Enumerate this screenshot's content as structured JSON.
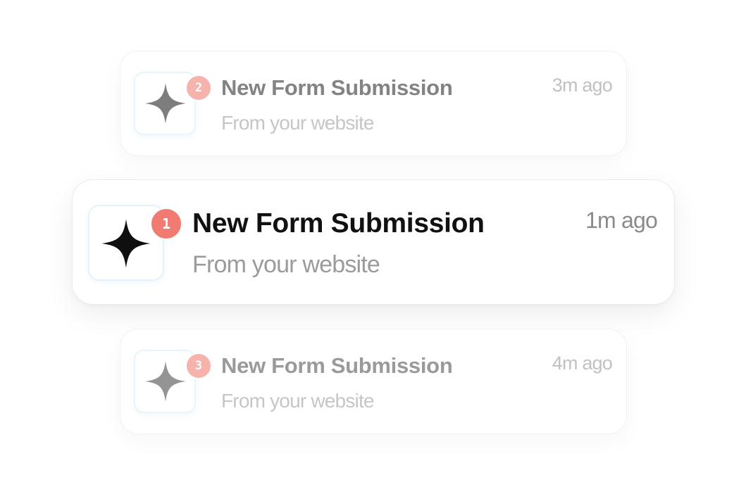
{
  "notifications": [
    {
      "badge": "2",
      "title": "New Form Submission",
      "subtitle": "From your website",
      "time": "3m ago",
      "icon": "sparkle-icon",
      "emphasis": "faded"
    },
    {
      "badge": "1",
      "title": "New Form Submission",
      "subtitle": "From your website",
      "time": "1m ago",
      "icon": "sparkle-icon",
      "emphasis": "active"
    },
    {
      "badge": "3",
      "title": "New Form Submission",
      "subtitle": "From your website",
      "time": "4m ago",
      "icon": "sparkle-icon",
      "emphasis": "faded"
    }
  ],
  "colors": {
    "badge_active": "#f17b70",
    "badge_faded": "#f6b3ac",
    "title_active": "#111111",
    "title_faded": "#838383",
    "icon_active": "#111111",
    "icon_faded": "#7a7a7a",
    "icon_border": "#e3f3fa"
  }
}
